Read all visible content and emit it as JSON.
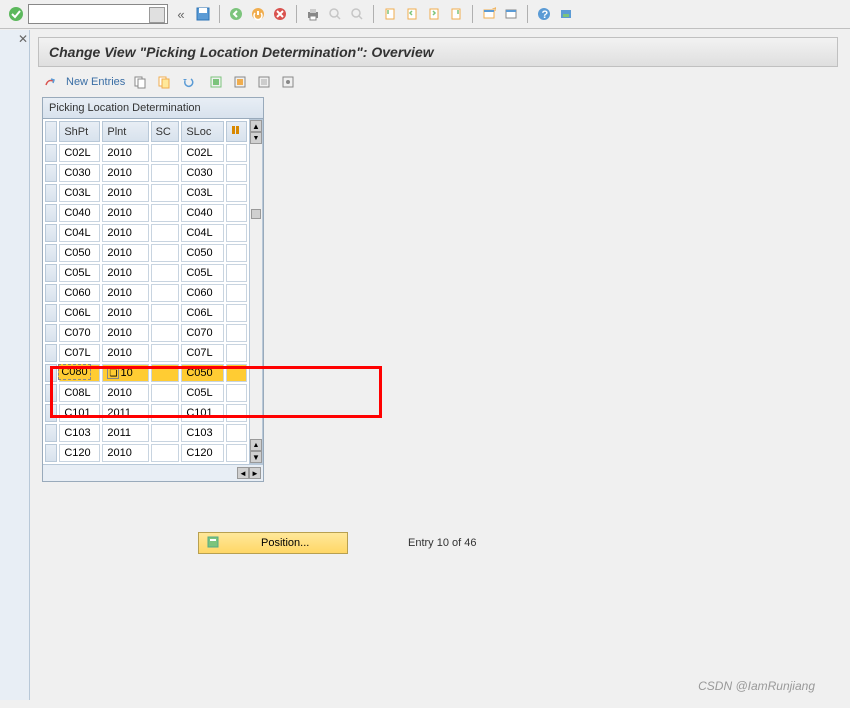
{
  "toolbar": {
    "back_label": "«"
  },
  "title": "Change View \"Picking Location Determination\": Overview",
  "toolbar2": {
    "new_entries": "New Entries"
  },
  "table": {
    "header": "Picking Location Determination",
    "columns": {
      "shpt": "ShPt",
      "plnt": "Plnt",
      "sc": "SC",
      "sloc": "SLoc"
    },
    "rows": [
      {
        "shpt": "C02L",
        "plnt": "2010",
        "sc": "",
        "sloc": "C02L"
      },
      {
        "shpt": "C030",
        "plnt": "2010",
        "sc": "",
        "sloc": "C030"
      },
      {
        "shpt": "C03L",
        "plnt": "2010",
        "sc": "",
        "sloc": "C03L"
      },
      {
        "shpt": "C040",
        "plnt": "2010",
        "sc": "",
        "sloc": "C040"
      },
      {
        "shpt": "C04L",
        "plnt": "2010",
        "sc": "",
        "sloc": "C04L"
      },
      {
        "shpt": "C050",
        "plnt": "2010",
        "sc": "",
        "sloc": "C050"
      },
      {
        "shpt": "C05L",
        "plnt": "2010",
        "sc": "",
        "sloc": "C05L"
      },
      {
        "shpt": "C060",
        "plnt": "2010",
        "sc": "",
        "sloc": "C060"
      },
      {
        "shpt": "C06L",
        "plnt": "2010",
        "sc": "",
        "sloc": "C06L"
      },
      {
        "shpt": "C070",
        "plnt": "2010",
        "sc": "",
        "sloc": "C070"
      },
      {
        "shpt": "C07L",
        "plnt": "2010",
        "sc": "",
        "sloc": "C07L"
      },
      {
        "shpt": "C080",
        "plnt": "2010",
        "sc": "",
        "sloc": "C050",
        "selected": true
      },
      {
        "shpt": "C08L",
        "plnt": "2010",
        "sc": "",
        "sloc": "C05L"
      },
      {
        "shpt": "C101",
        "plnt": "2011",
        "sc": "",
        "sloc": "C101"
      },
      {
        "shpt": "C103",
        "plnt": "2011",
        "sc": "",
        "sloc": "C103"
      },
      {
        "shpt": "C120",
        "plnt": "2010",
        "sc": "",
        "sloc": "C120"
      }
    ]
  },
  "footer": {
    "position_label": "Position...",
    "entry_text": "Entry 10 of 46"
  },
  "watermark": "CSDN @IamRunjiang",
  "selected_row_display": {
    "shpt": "C080",
    "plnt": "10"
  }
}
